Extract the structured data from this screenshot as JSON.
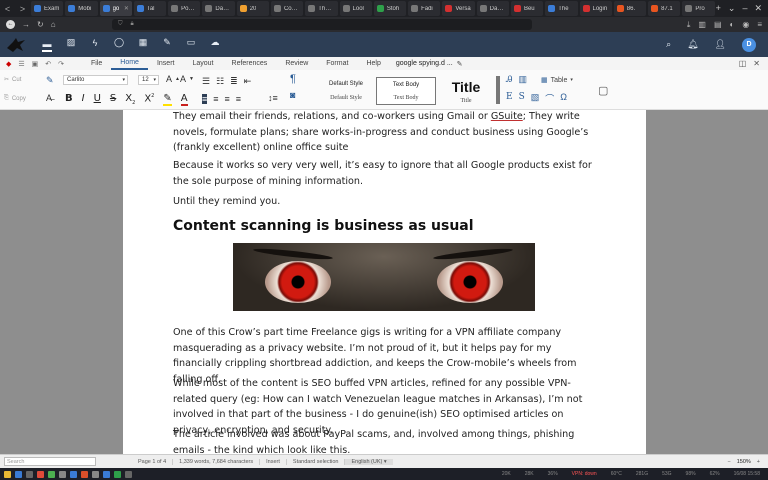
{
  "browser": {
    "tabs": [
      {
        "label": "Exam",
        "color": "#3b7dd8"
      },
      {
        "label": "Mobi",
        "color": "#3b7dd8"
      },
      {
        "label": "go",
        "color": "#3b7dd8",
        "active": true
      },
      {
        "label": "Tal",
        "color": "#3b7dd8"
      },
      {
        "label": "Posts ‹ Cro",
        "color": "#777777"
      },
      {
        "label": "Dashbo",
        "color": "#777777"
      },
      {
        "label": "20",
        "color": "#f0a030"
      },
      {
        "label": "Comme",
        "color": "#777777"
      },
      {
        "label": "The Cro",
        "color": "#777777"
      },
      {
        "label": "Lool",
        "color": "#777777"
      },
      {
        "label": "Stoh",
        "color": "#2ea04a"
      },
      {
        "label": "Fadi",
        "color": "#777777"
      },
      {
        "label": "Versa",
        "color": "#d33030"
      },
      {
        "label": "Daniel F",
        "color": "#777777"
      },
      {
        "label": "Beu",
        "color": "#d33030"
      },
      {
        "label": "The",
        "color": "#3b7dd8"
      },
      {
        "label": "Login",
        "color": "#d33030"
      },
      {
        "label": "86.",
        "color": "#e85520"
      },
      {
        "label": "87.1",
        "color": "#e85520"
      },
      {
        "label": "Pro",
        "color": "#777777"
      }
    ],
    "new_tab": "+",
    "nav_back": "<",
    "nav_forward": ">"
  },
  "ribbon": {
    "menu_tabs": [
      "File",
      "Home",
      "Insert",
      "Layout",
      "References",
      "Review",
      "Format",
      "Help"
    ],
    "active_tab": "Home",
    "doc_name": "google spying.d ...",
    "cut": "Cut",
    "copy": "Copy",
    "font": "Carlito",
    "size": "12",
    "styles": [
      {
        "top": "Default Style",
        "bottom": "Default Style",
        "selected": false
      },
      {
        "top": "Text Body",
        "bottom": "Text Body",
        "selected": true
      },
      {
        "top": "Title",
        "bottom": "Title",
        "selected": false,
        "big": true
      }
    ],
    "table_label": "Table"
  },
  "document": {
    "paragraphs": [
      {
        "html_before": "They email their friends, relations, and co-workers using Gmail or ",
        "underline": "GSuite",
        "html_after": "; They write novels, formulate plans; share works-in-progress and conduct business using Google’s (frankly excellent) online office suite"
      },
      {
        "text": "Because it works so very very well, it’s easy to ignore that all Google products exist for the sole purpose of mining information."
      },
      {
        "text": "Until they remind you."
      }
    ],
    "heading": "Content scanning is business as usual",
    "paragraphs_after": [
      "One of this Crow’s part time Freelance gigs is writing for a VPN affiliate company masquerading as a privacy website. I’m not proud of it, but it helps pay for my financially crippling shortbread addiction, and keeps the Crow-mobile’s wheels from falling off.",
      "While most of the content is SEO buffed VPN articles, refined for any possible VPN-related query (eg: How can I watch Venezuelan league matches in Arkansas), I’m not involved in that part of the business - I do genuine(ish) SEO optimised articles on privacy, encryption, and security.",
      "The article involved was about PayPal scams, and, involved among things, phishing emails - the kind which look like this."
    ]
  },
  "status": {
    "search_placeholder": "Search",
    "page": "Page 1 of 4",
    "counts": "1,339 words, 7,684 characters",
    "mode": "Insert",
    "selection": "Standard selection",
    "language": "English (UK)",
    "zoom": "150%"
  },
  "taskbar": {
    "net": "20K",
    "net2": "28K",
    "cpu": "36%",
    "vpn": "VPN: down",
    "temp": "60°C",
    "mem": "281G",
    "disk": "53G",
    "ups": "98%",
    "vol": "62%",
    "clock": "16/08 15:58"
  }
}
